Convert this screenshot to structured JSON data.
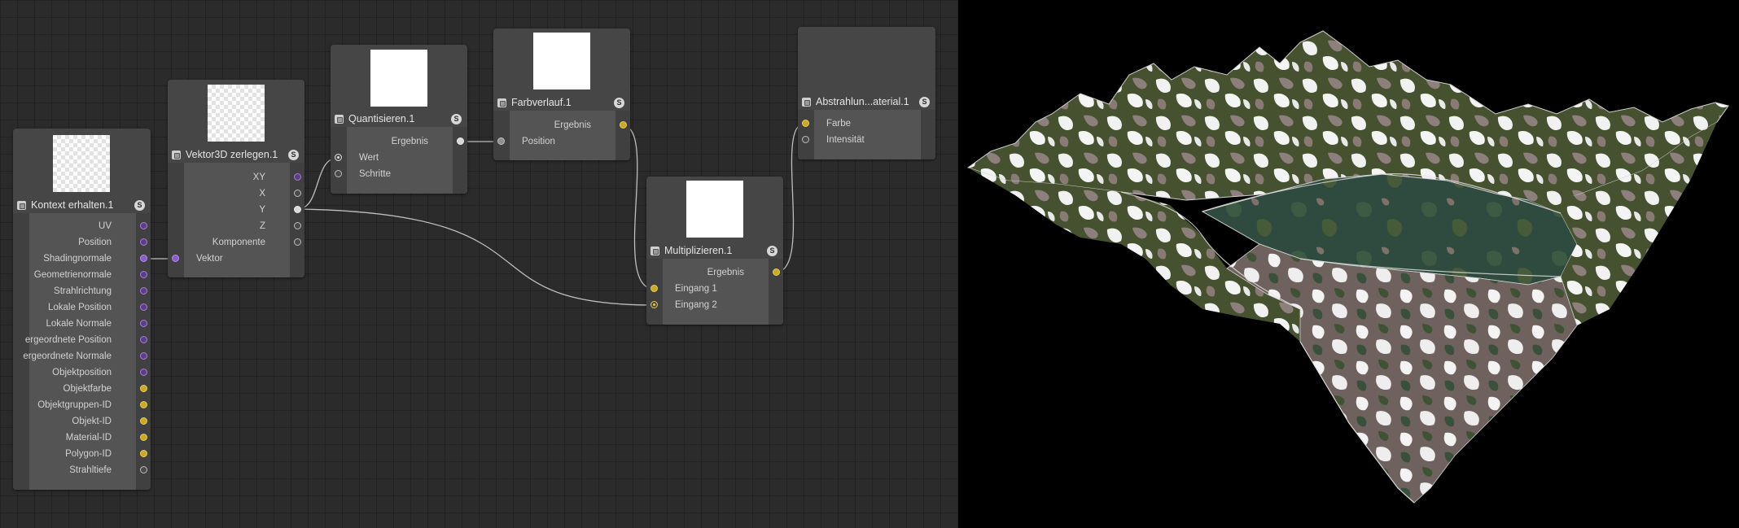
{
  "nodes": {
    "kontext": {
      "title": "Kontext erhalten.1",
      "outputs": [
        "UV",
        "Position",
        "Shadingnormale",
        "Geometrienormale",
        "Strahlrichtung",
        "Lokale Position",
        "Lokale Normale",
        "ergeordnete Position",
        "ergeordnete Normale",
        "Objektposition",
        "Objektfarbe",
        "Objektgruppen-ID",
        "Objekt-ID",
        "Material-ID",
        "Polygon-ID",
        "Strahltiefe"
      ]
    },
    "vektor": {
      "title": "Vektor3D zerlegen.1",
      "outputs": [
        "XY",
        "X",
        "Y",
        "Z",
        "Komponente"
      ],
      "inputs": [
        "Vektor"
      ]
    },
    "quant": {
      "title": "Quantisieren.1",
      "outputs": [
        "Ergebnis"
      ],
      "inputs": [
        "Wert",
        "Schritte"
      ]
    },
    "farb": {
      "title": "Farbverlauf.1",
      "outputs": [
        "Ergebnis"
      ],
      "inputs": [
        "Position"
      ]
    },
    "multi": {
      "title": "Multiplizieren.1",
      "outputs": [
        "Ergebnis"
      ],
      "inputs": [
        "Eingang 1",
        "Eingang 2"
      ]
    },
    "abstr": {
      "title": "Abstrahlun...aterial.1",
      "inputs": [
        "Farbe",
        "Intensität"
      ]
    }
  },
  "badge_label": "S",
  "colors": {
    "editor_bg": "#2b2b2b",
    "port_vector": "#8a5cc8",
    "port_color": "#c9a82a",
    "port_float": "#8e8e8e",
    "viewport_bg": "#000000",
    "terrain_green": "#3d4a2e",
    "terrain_rock": "#8a7d78",
    "terrain_snow": "#f2f2f2"
  }
}
